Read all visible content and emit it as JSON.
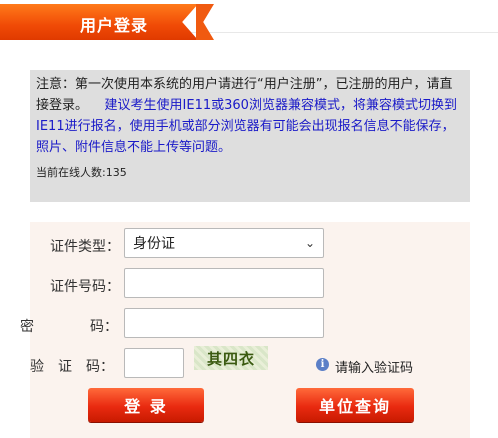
{
  "header": {
    "title": "用户登录"
  },
  "notice": {
    "text_black": "注意：第一次使用本系统的用户请进行“用户注册”，已注册的用户，请直接登录。",
    "text_blue": "建议考生使用IE11或360浏览器兼容模式，将兼容模式切换到IE11进行报名，使用手机或部分浏览器有可能会出现报名信息不能保存，照片、附件信息不能上传等问题。",
    "online_label": "当前在线人数:",
    "online_count": "135"
  },
  "form": {
    "id_type_label": "证件类型：",
    "id_type_value": "身份证",
    "id_number_label": "证件号码：",
    "id_number_value": "",
    "password_label_left": "密",
    "password_label_right": "码：",
    "password_value": "",
    "captcha_label": "验　证　码：",
    "captcha_value": "",
    "captcha_image_text": "其四衣",
    "captcha_hint": "请输入验证码"
  },
  "buttons": {
    "login": "登 录",
    "unit_query": "单位查询"
  },
  "colors": {
    "brand_orange": "#f04a06",
    "button_red": "#e92a10",
    "notice_blue": "#1a1ac8"
  }
}
